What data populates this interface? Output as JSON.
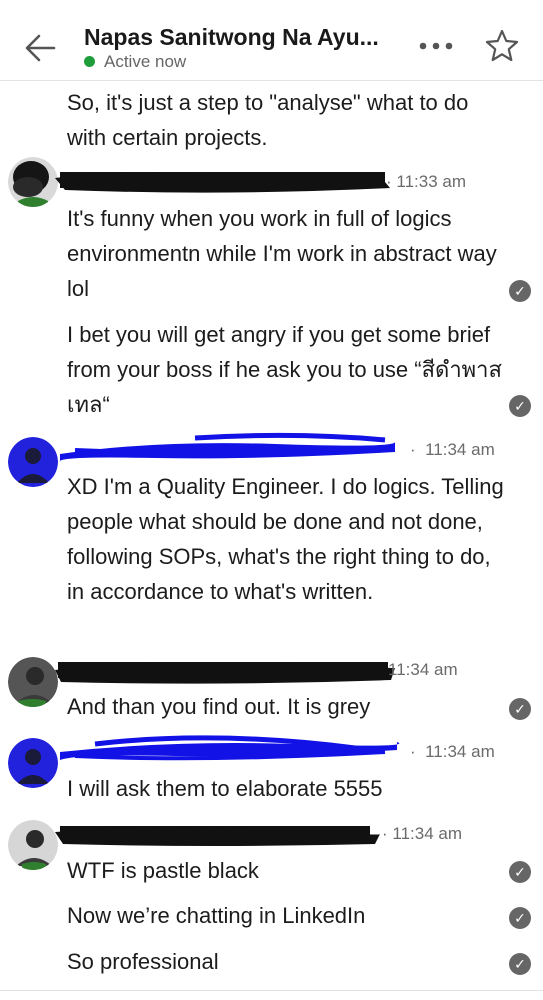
{
  "header": {
    "title": "Napas Sanitwong Na Ayu...",
    "status": "Active now"
  },
  "messages": [
    {
      "text": "So, it's just a step to \"analyse\" what to do with certain projects."
    },
    {
      "time": "11:33 am"
    },
    {
      "text": "It's funny when you work in full of logics environmentn while I'm work in abstract way lol"
    },
    {
      "text": "I bet you will get angry if you get some brief from your boss if he ask you to use “สีดำพาสเทล“"
    },
    {
      "time": "11:34 am"
    },
    {
      "text": "XD I'm a Quality Engineer. I do logics. Telling people what should be done and not done, following SOPs, what's the right thing to do, in accordance to what's written."
    },
    {
      "time": "11:34 am"
    },
    {
      "text": "And than you find out. It is grey"
    },
    {
      "time": "11:34 am"
    },
    {
      "text": "I will ask them to elaborate 5555"
    },
    {
      "time": "11:34 am"
    },
    {
      "text": "WTF is pastle black"
    },
    {
      "text": "Now we’re chatting in LinkedIn"
    },
    {
      "text": "So professional"
    }
  ],
  "icons": {
    "back": "arrow-left-icon",
    "more": "more-horizontal-icon",
    "star": "star-icon",
    "read": "check-circle-icon"
  },
  "colors": {
    "active": "#1f9d3b",
    "redaction_black": "#111111",
    "redaction_blue": "#1212e6"
  }
}
